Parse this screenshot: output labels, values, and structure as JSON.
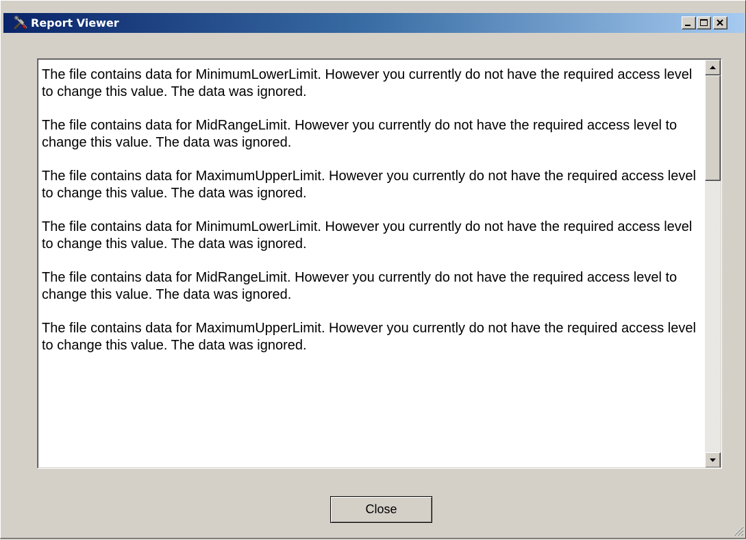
{
  "window": {
    "title": "Report Viewer"
  },
  "report": {
    "paragraphs": [
      "The file contains data for MinimumLowerLimit. However you currently do not have the required access level to change this value. The data was ignored.",
      "The file contains data for MidRangeLimit. However you currently do not have the required access level to change this value. The data was ignored.",
      "The file contains data for MaximumUpperLimit. However you currently do not have the required access level to change this value. The data was ignored.",
      "The file contains data for MinimumLowerLimit. However you currently do not have the required access level to change this value. The data was ignored.",
      "The file contains data for MidRangeLimit. However you currently do not have the required access level to change this value. The data was ignored.",
      "The file contains data for MaximumUpperLimit. However you currently do not have the required access level to change this value. The data was ignored."
    ]
  },
  "buttons": {
    "close_label": "Close"
  },
  "icons": {
    "app": "tools-icon",
    "minimize": "minimize-icon",
    "maximize": "maximize-icon",
    "close": "close-icon",
    "scroll_up": "arrow-up-icon",
    "scroll_down": "arrow-down-icon",
    "resize": "resize-grip-icon"
  },
  "colors": {
    "titlebar_start": "#0a246a",
    "titlebar_end": "#a6caf0",
    "face": "#d4d0c8"
  }
}
